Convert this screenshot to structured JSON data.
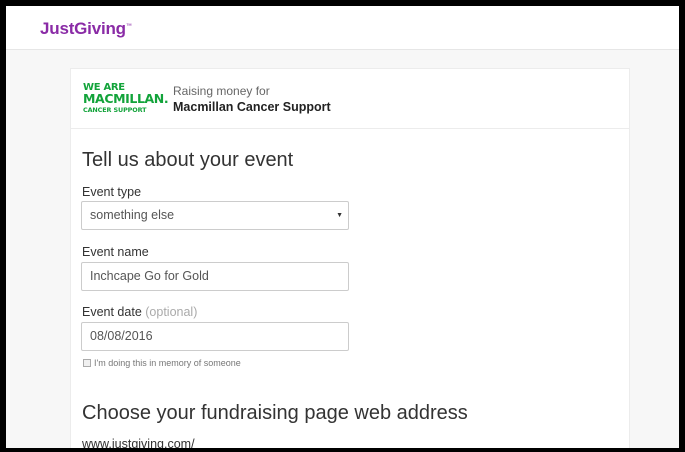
{
  "header": {
    "logo_text": "JustGiving",
    "logo_tm": "™"
  },
  "charity": {
    "logo_line1": "WE ARE",
    "logo_line2": "MACMILLAN.",
    "logo_line3": "CANCER SUPPORT",
    "raising_label": "Raising money for",
    "name": "Macmillan Cancer Support"
  },
  "event_section": {
    "heading": "Tell us about your event",
    "event_type": {
      "label": "Event type",
      "value": "something else"
    },
    "event_name": {
      "label": "Event name",
      "value": "Inchcape Go for Gold"
    },
    "event_date": {
      "label": "Event date",
      "optional_label": "(optional)",
      "value": "08/08/2016"
    },
    "memory_checkbox_label": "I'm doing this in memory of someone"
  },
  "address_section": {
    "heading": "Choose your fundraising page web address",
    "prefix": "www.justgiving.com/"
  },
  "colors": {
    "brand_purple": "#8a2ba6",
    "macmillan_green": "#12a33a"
  },
  "icons": {
    "dropdown": "caret-down-icon",
    "checkbox": "checkbox-icon"
  }
}
